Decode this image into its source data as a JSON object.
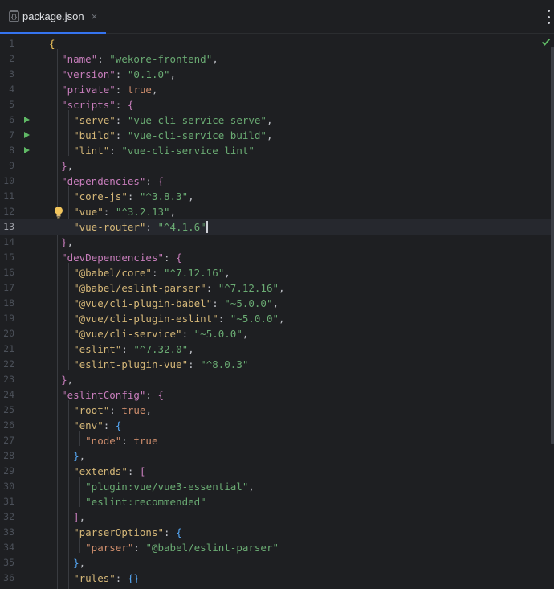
{
  "tab": {
    "file_name": "package.json",
    "close_glyph": "×",
    "icon": "json-file-icon"
  },
  "editor": {
    "current_line": 13,
    "lines": [
      {
        "n": "1"
      },
      {
        "n": "2"
      },
      {
        "n": "3"
      },
      {
        "n": "4"
      },
      {
        "n": "5"
      },
      {
        "n": "6"
      },
      {
        "n": "7"
      },
      {
        "n": "8"
      },
      {
        "n": "9"
      },
      {
        "n": "10"
      },
      {
        "n": "11"
      },
      {
        "n": "12"
      },
      {
        "n": "13"
      },
      {
        "n": "14"
      },
      {
        "n": "15"
      },
      {
        "n": "16"
      },
      {
        "n": "17"
      },
      {
        "n": "18"
      },
      {
        "n": "19"
      },
      {
        "n": "20"
      },
      {
        "n": "21"
      },
      {
        "n": "22"
      },
      {
        "n": "23"
      },
      {
        "n": "24"
      },
      {
        "n": "25"
      },
      {
        "n": "26"
      },
      {
        "n": "27"
      },
      {
        "n": "28"
      },
      {
        "n": "29"
      },
      {
        "n": "30"
      },
      {
        "n": "31"
      },
      {
        "n": "32"
      },
      {
        "n": "33"
      },
      {
        "n": "34"
      },
      {
        "n": "35"
      },
      {
        "n": "36"
      }
    ],
    "code": {
      "l1_open": "{",
      "name_key": "\"name\"",
      "name_val": "\"wekore-frontend\"",
      "version_key": "\"version\"",
      "version_val": "\"0.1.0\"",
      "private_key": "\"private\"",
      "private_val": "true",
      "scripts_key": "\"scripts\"",
      "serve_key": "\"serve\"",
      "serve_val": "\"vue-cli-service serve\"",
      "build_key": "\"build\"",
      "build_val": "\"vue-cli-service build\"",
      "lint_key": "\"lint\"",
      "lint_val": "\"vue-cli-service lint\"",
      "dependencies_key": "\"dependencies\"",
      "corejs_key": "\"core-js\"",
      "corejs_val": "\"^3.8.3\"",
      "vue_key": "\"vue\"",
      "vue_val": "\"^3.2.13\"",
      "vuerouter_key": "\"vue-router\"",
      "vuerouter_val": "\"^4.1.6\"",
      "devdeps_key": "\"devDependencies\"",
      "babelcore_key": "\"@babel/core\"",
      "babelcore_val": "\"^7.12.16\"",
      "babelparser_key": "\"@babel/eslint-parser\"",
      "babelparser_val": "\"^7.12.16\"",
      "pluginbabel_key": "\"@vue/cli-plugin-babel\"",
      "pluginbabel_val": "\"~5.0.0\"",
      "plugineslint_key": "\"@vue/cli-plugin-eslint\"",
      "plugineslint_val": "\"~5.0.0\"",
      "cliservice_key": "\"@vue/cli-service\"",
      "cliservice_val": "\"~5.0.0\"",
      "eslint_key": "\"eslint\"",
      "eslint_val": "\"^7.32.0\"",
      "eslintvue_key": "\"eslint-plugin-vue\"",
      "eslintvue_val": "\"^8.0.3\"",
      "eslintconfig_key": "\"eslintConfig\"",
      "root_key": "\"root\"",
      "root_val": "true",
      "env_key": "\"env\"",
      "node_key": "\"node\"",
      "node_val": "true",
      "extends_key": "\"extends\"",
      "ext1": "\"plugin:vue/vue3-essential\"",
      "ext2": "\"eslint:recommended\"",
      "parseroptions_key": "\"parserOptions\"",
      "parser_key": "\"parser\"",
      "parser_val": "\"@babel/eslint-parser\"",
      "rules_key": "\"rules\"",
      "rules_val": "{}"
    }
  },
  "status": {
    "inspection": "check-icon"
  },
  "colors": {
    "background": "#1e1f22",
    "string": "#6aab73",
    "keyword": "#cf8e6d",
    "key_level1": "#c77dbb",
    "key_level2": "#d5b778",
    "run_gutter": "#5fb865",
    "tab_underline": "#3574f0"
  }
}
